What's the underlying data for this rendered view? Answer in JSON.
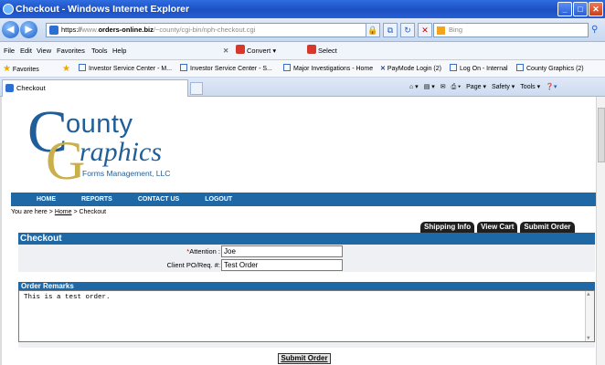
{
  "window": {
    "title": "Checkout - Windows Internet Explorer"
  },
  "address": {
    "protocol": "https://",
    "prefix": "www.",
    "domain": "orders-online.biz",
    "path": "/~county/cgi-bin/nph-checkout.cgi"
  },
  "search": {
    "placeholder": "Bing"
  },
  "menu": {
    "items": [
      "File",
      "Edit",
      "View",
      "Favorites",
      "Tools",
      "Help"
    ],
    "convert": "Convert",
    "select": "Select"
  },
  "favorites": {
    "label": "Favorites",
    "items": [
      "Investor Service Center - M...",
      "Investor Service Center - S...",
      "Major Investigations - Home",
      "PayMode Login (2)",
      "Log On - Internal",
      "County Graphics (2)"
    ]
  },
  "tab": {
    "label": "Checkout"
  },
  "commandbar": {
    "page": "Page",
    "safety": "Safety",
    "tools": "Tools"
  },
  "logo": {
    "word1": "ounty",
    "word2": "raphics",
    "tagline": "Forms Management, LLC",
    "initial1": "C",
    "initial2": "G"
  },
  "site_nav": [
    "HOME",
    "REPORTS",
    "CONTACT US",
    "LOGOUT"
  ],
  "breadcrumb": {
    "prefix": "You are here > ",
    "home": "Home",
    "current": " > Checkout"
  },
  "actions": {
    "shipping": "Shipping Info",
    "cart": "View Cart",
    "submit": "Submit Order"
  },
  "checkout": {
    "title": "Checkout",
    "attention_label": "Attention :",
    "attention_value": "Joe",
    "po_label": "Client PO/Req. #:",
    "po_value": "Test Order"
  },
  "remarks": {
    "title": "Order Remarks",
    "text": "This is a test order."
  },
  "submit_button": "Submit Order",
  "colors": {
    "nav_blue": "#1e68a6",
    "logo_blue": "#1f5e99",
    "logo_gold": "#c9b04a"
  }
}
